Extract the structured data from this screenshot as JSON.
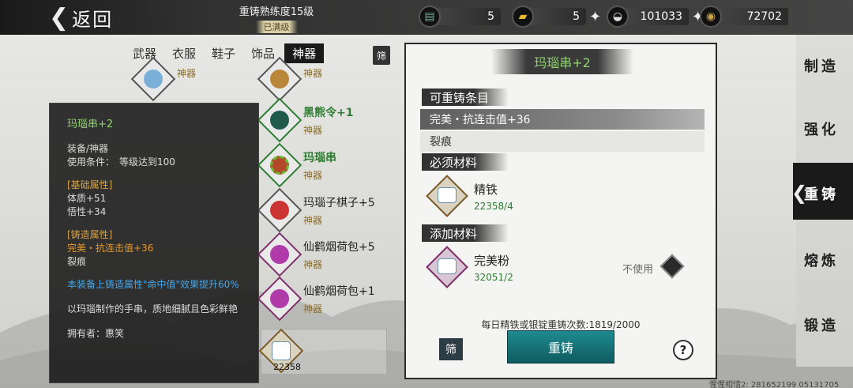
{
  "header": {
    "back_label": "返回",
    "proficiency": "重铸熟练度15级",
    "proficiency_status": "已满级"
  },
  "resources": [
    {
      "icon": "ticket-icon",
      "value": "5"
    },
    {
      "icon": "gold-bar-icon",
      "value": "5"
    },
    {
      "icon": "silver-ingot-icon",
      "value": "101033"
    },
    {
      "icon": "copper-coin-icon",
      "value": "72702"
    }
  ],
  "tabs": [
    "武器",
    "衣服",
    "鞋子",
    "饰品",
    "神器"
  ],
  "active_tab": "神器",
  "filter_label": "筛",
  "items": [
    {
      "name": "",
      "type": "神器"
    },
    {
      "name": "",
      "type": "神器"
    },
    {
      "name": "黑熊令+1",
      "type": "神器"
    },
    {
      "name": "玛瑙串",
      "type": "神器"
    },
    {
      "name": "玛瑙子棋子+5",
      "type": "神器"
    },
    {
      "name": "仙鹤烟荷包+5",
      "type": "神器"
    },
    {
      "name": "仙鹤烟荷包+1",
      "type": "神器"
    }
  ],
  "selected_item_qty": "22358",
  "tooltip": {
    "title": "玛瑙串+2",
    "category": "装备/神器",
    "requirement": "使用条件：　等级达到100",
    "base_header": "[基础属性]",
    "base_1": "体质+51",
    "base_2": "悟性+34",
    "forge_header": "[铸造属性]",
    "forge_1": "完美・抗连击值+36",
    "forge_2": "裂痕",
    "bonus": "本装备上铸造属性\"命中值\"效果提升60%",
    "description": "以玛瑙制作的手串，质地细腻且色彩鲜艳",
    "owner": "拥有者：惠笑"
  },
  "panel": {
    "title": "玛瑙串+2",
    "reforgeable_header": "可重铸条目",
    "entry_selected": "完美・抗连击值+36",
    "entry_other": "裂痕",
    "required_header": "必须材料",
    "required_name": "精铁",
    "required_count": "22358/4",
    "extra_header": "添加材料",
    "extra_name": "完美粉",
    "extra_count": "32051/2",
    "not_use": "不使用",
    "daily": "每日精铁或银锭重铸次数:1819/2000",
    "filter_label": "筛",
    "reforge_button": "重铸",
    "help": "?"
  },
  "side_nav": [
    "制造",
    "强化",
    "重铸",
    "熔炼",
    "锻造"
  ],
  "side_nav_active": "重铸",
  "watermark": "惺惺相惜2: 281652199  05131705"
}
